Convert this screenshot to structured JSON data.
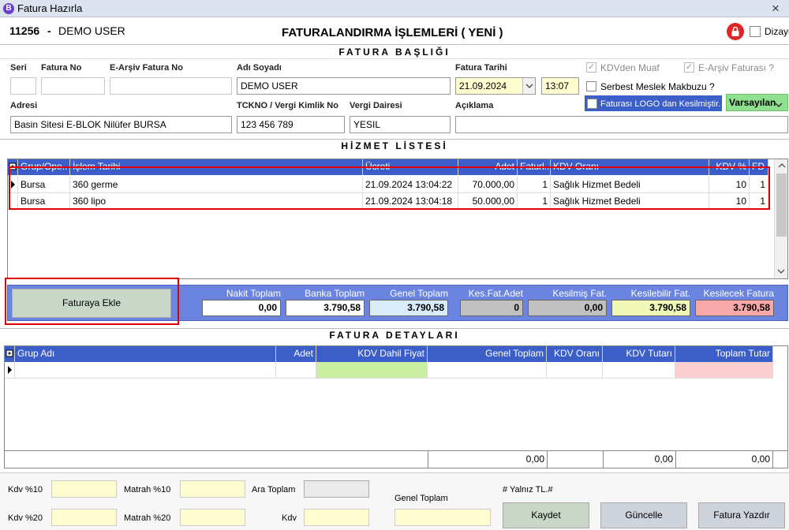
{
  "window": {
    "title": "Fatura Hazırla",
    "app_icon_letter": "B",
    "close": "×"
  },
  "header": {
    "customer_code": "11256",
    "separator": "-",
    "customer_name": "DEMO USER",
    "title": "FATURALANDIRMA İŞLEMLERİ ( YENİ )",
    "dizayn_label": "Dizayn"
  },
  "fatura_basligi": {
    "section_title": "FATURA BAŞLIĞI",
    "seri_label": "Seri",
    "seri_value": "",
    "fatura_no_label": "Fatura No",
    "fatura_no_value": "",
    "earsiv_no_label": "E-Arşiv Fatura No",
    "earsiv_no_value": "",
    "adi_soyadi_label": "Adı Soyadı",
    "adi_soyadi_value": "DEMO USER",
    "fatura_tarihi_label": "Fatura Tarihi",
    "fatura_tarihi_value": "21.09.2024",
    "saat_value": "13:07",
    "kdv_muaf_label": "KDVden Muaf",
    "earsiv_faturasi_label": "E-Arşiv Faturası ?",
    "serbest_meslek_label": "Serbest Meslek Makbuzu ?",
    "logo_kesilmistir_label": "Faturası LOGO dan Kesilmiştir.",
    "varsayilan_label": "Varsayılan",
    "adresi_label": "Adresi",
    "adresi_value": "Basin Sitesi E-BLOK Nilüfer BURSA",
    "tckno_label": "TCKNO / Vergi Kimlik No",
    "tckno_value": "123 456 789",
    "vergi_dairesi_label": "Vergi Dairesi",
    "vergi_dairesi_value": "YESIL",
    "aciklama_label": "Açıklama",
    "aciklama_value": ""
  },
  "hizmet_listesi": {
    "section_title": "HİZMET LİSTESİ",
    "columns": [
      "Grup/Ope..",
      "İşlem Tarihi",
      "Ücreti",
      "Adet",
      "Faturl..",
      "KDV Oranı",
      "KDV %",
      "FD"
    ],
    "rows": [
      {
        "grup": "Bursa",
        "islem": "360 germe",
        "tarih": "21.09.2024 13:04:22",
        "ucret": "70.000,00",
        "adet": "1",
        "kdv_orani": "Sağlık Hizmet Bedeli",
        "kdv": "10",
        "fd": "1"
      },
      {
        "grup": "Bursa",
        "islem": "360 lipo",
        "tarih": "21.09.2024 13:04:18",
        "ucret": "50.000,00",
        "adet": "1",
        "kdv_orani": "Sağlık Hizmet Bedeli",
        "kdv": "10",
        "fd": "1"
      }
    ]
  },
  "totals": {
    "faturaya_ekle": "Faturaya Ekle",
    "nakit_label": "Nakit Toplam",
    "nakit_value": "0,00",
    "banka_label": "Banka Toplam",
    "banka_value": "3.790,58",
    "genel_label": "Genel Toplam",
    "genel_value": "3.790,58",
    "kes_adet_label": "Kes.Fat.Adet",
    "kes_adet_value": "0",
    "kesilmis_label": "Kesilmiş Fat.",
    "kesilmis_value": "0,00",
    "kesilebilir_label": "Kesilebilir Fat.",
    "kesilebilir_value": "3.790,58",
    "kesilecek_label": "Kesilecek Fatura",
    "kesilecek_value": "3.790,58"
  },
  "fatura_detaylari": {
    "section_title": "FATURA DETAYLARI",
    "columns": [
      "Grup Adı",
      "Adet",
      "KDV Dahil Fiyat",
      "Genel Toplam",
      "KDV Oranı",
      "KDV Tutarı",
      "Toplam Tutar"
    ],
    "footer": {
      "genel_toplam": "0,00",
      "kdv_tutari": "0,00",
      "toplam_tutar": "0,00"
    }
  },
  "bottom": {
    "kdv10_label": "Kdv %10",
    "matrah10_label": "Matrah %10",
    "ara_toplam_label": "Ara Toplam",
    "kdv20_label": "Kdv %20",
    "matrah20_label": "Matrah %20",
    "kdv_label": "Kdv",
    "genel_toplam_label": "Genel Toplam",
    "yalniz_label": "# Yalnız TL.#",
    "kaydet": "Kaydet",
    "guncelle": "Güncelle",
    "fatura_yazdir": "Fatura Yazdır"
  },
  "colors": {
    "accent_blue": "#3b5ec9",
    "highlight_red": "#e00000",
    "yellow_input": "#fffdd0",
    "green_btn": "#8fe08f"
  }
}
